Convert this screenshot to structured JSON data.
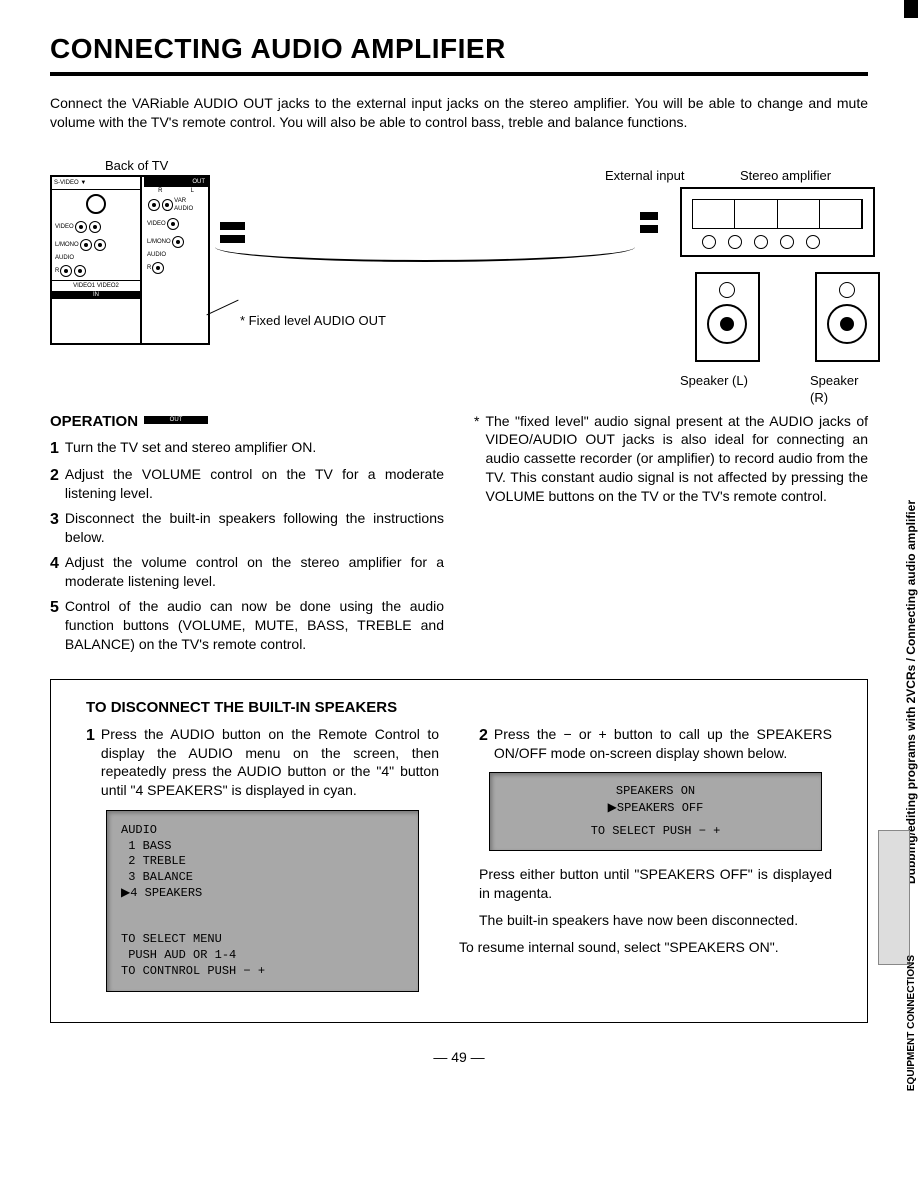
{
  "title": "CONNECTING AUDIO AMPLIFIER",
  "intro": "Connect the VARiable AUDIO OUT jacks to the external input jacks on the stereo amplifier. You will be able to change and mute volume with the TV's remote control. You will also be able to control bass, treble and balance functions.",
  "diagram": {
    "back_of_tv": "Back of TV",
    "external_input": "External input",
    "stereo_amplifier": "Stereo amplifier",
    "fixed_level_out": "* Fixed level AUDIO OUT",
    "speaker_l": "Speaker (L)",
    "speaker_r": "Speaker (R)",
    "svideo": "S-VIDEO ▼",
    "out": "OUT",
    "in": "IN",
    "var_audio": "VAR AUDIO",
    "video": "VIDEO",
    "l_mono": "L/MONO",
    "audio": "AUDIO",
    "r": "R",
    "l": "L",
    "video1": "VIDEO1",
    "video2": "VIDEO2"
  },
  "operation": {
    "heading": "OPERATION",
    "steps": [
      "Turn the TV set and stereo amplifier ON.",
      "Adjust the VOLUME control on the TV for a moderate listening level.",
      "Disconnect the built-in speakers following the instructions below.",
      "Adjust the volume control on the stereo amplifier for a moderate listening level.",
      "Control of the audio can now be done using the audio function buttons (VOLUME, MUTE, BASS, TREBLE and BALANCE) on the TV's remote control."
    ],
    "note": "The \"fixed level\" audio signal present at the AUDIO jacks of VIDEO/AUDIO OUT jacks is also ideal for connecting an audio cassette recorder (or amplifier) to record audio from the TV. This constant audio signal is not affected by pressing the VOLUME buttons on the TV or the TV's remote control."
  },
  "disconnect": {
    "heading": "TO DISCONNECT THE BUILT-IN SPEAKERS",
    "step1": "Press the AUDIO button on the Remote Control to display the AUDIO menu on the screen, then repeatedly press the AUDIO button or the \"4\" button until \"4 SPEAKERS\" is displayed in cyan.",
    "step2": "Press the − or + button to call up the SPEAKERS ON/OFF mode on-screen display shown below.",
    "screen1": "AUDIO\n 1 BASS\n 2 TREBLE\n 3 BALANCE\n▶4 SPEAKERS\n\n\nTO SELECT MENU\n PUSH AUD OR 1-4\nTO CONTNROL PUSH − +",
    "screen2_line1": "SPEAKERS ON",
    "screen2_line2": "▶SPEAKERS OFF",
    "screen2_line3": "TO SELECT PUSH − +",
    "after1": "Press either button until \"SPEAKERS OFF\" is displayed in magenta.",
    "after2": "The built-in speakers have now been disconnected.",
    "resume": "To resume internal sound, select \"SPEAKERS ON\"."
  },
  "page_number": "— 49 —",
  "side_section": "Dubbing/editing programs with 2VCRs / Connecting audio amplifier",
  "side_tab": "EQUIPMENT\nCONNECTIONS"
}
